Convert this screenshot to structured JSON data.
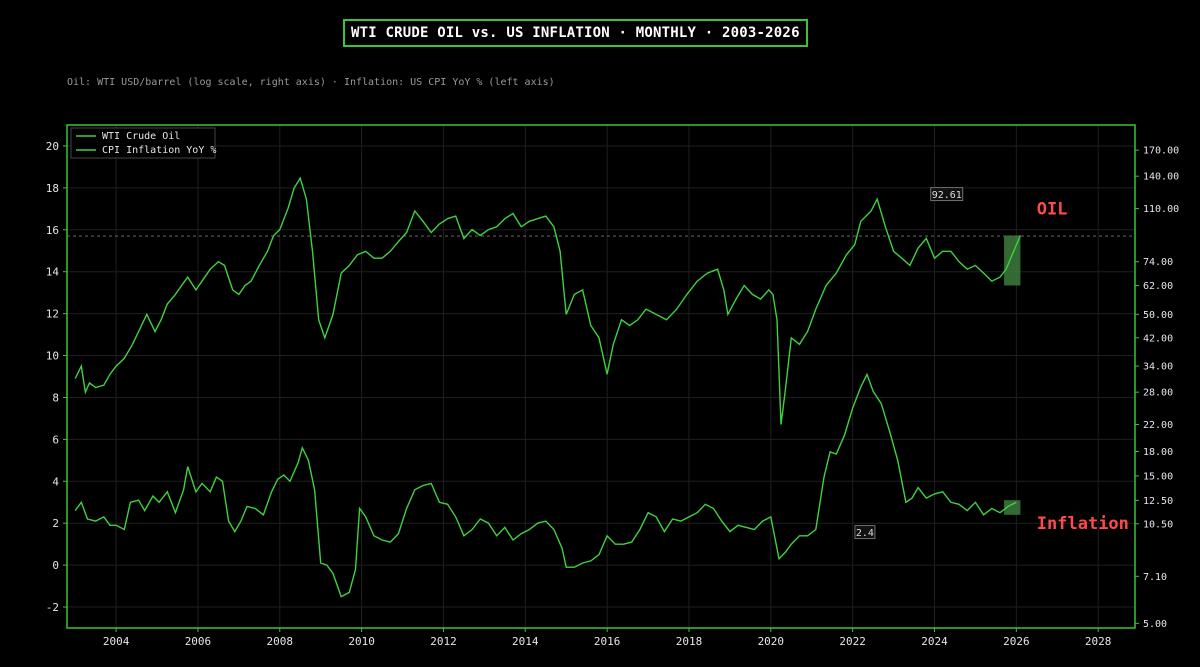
{
  "header": {
    "title": "WTI CRUDE OIL vs. US INFLATION  ·  MONTHLY  ·  2003-2026",
    "subtitle": "Oil: WTI USD/barrel (log scale, right axis)  ·  Inflation: US CPI YoY % (left axis)"
  },
  "colors": {
    "background": "#000000",
    "frame": "#3ac43a",
    "oil_line": "#3fd23f",
    "cpi_line": "#3fd23f",
    "highlight": "#3d7a3d",
    "annotation_red": "#ff4a4a"
  },
  "chart_data": {
    "type": "line",
    "xlim": [
      2002.8,
      2028.9
    ],
    "x_ticks": [
      2004,
      2006,
      2008,
      2010,
      2012,
      2014,
      2016,
      2018,
      2020,
      2022,
      2024,
      2026,
      2028
    ],
    "left_axis": {
      "scale": "linear",
      "ylim": [
        -3,
        21
      ],
      "ticks": [
        -2,
        0,
        2,
        4,
        6,
        8,
        10,
        12,
        14,
        16,
        18,
        20
      ]
    },
    "right_axis": {
      "scale": "log",
      "ylim": [
        4.83,
        205
      ],
      "ticks": [
        5.0,
        7.1,
        10.5,
        12.5,
        15.0,
        18.0,
        22.0,
        28.0,
        34.0,
        42.0,
        50.0,
        62.0,
        74.0,
        110.0,
        140.0,
        170.0
      ]
    },
    "grid": true,
    "legend_position": "top-left",
    "reference_line": {
      "axis": "left",
      "value": 15.7,
      "style": "dashed"
    },
    "series": [
      {
        "name": "WTI Crude Oil",
        "axis": "right",
        "x": [
          2003.0,
          2003.15,
          2003.25,
          2003.35,
          2003.5,
          2003.7,
          2003.85,
          2004.0,
          2004.2,
          2004.4,
          2004.55,
          2004.75,
          2004.95,
          2005.1,
          2005.25,
          2005.45,
          2005.6,
          2005.75,
          2005.95,
          2006.1,
          2006.3,
          2006.5,
          2006.65,
          2006.85,
          2007.0,
          2007.15,
          2007.3,
          2007.5,
          2007.7,
          2007.85,
          2008.0,
          2008.2,
          2008.35,
          2008.5,
          2008.65,
          2008.8,
          2008.95,
          2009.1,
          2009.3,
          2009.5,
          2009.7,
          2009.9,
          2010.1,
          2010.3,
          2010.5,
          2010.7,
          2010.9,
          2011.1,
          2011.3,
          2011.5,
          2011.7,
          2011.9,
          2012.1,
          2012.3,
          2012.5,
          2012.7,
          2012.9,
          2013.1,
          2013.3,
          2013.5,
          2013.7,
          2013.9,
          2014.1,
          2014.3,
          2014.5,
          2014.7,
          2014.85,
          2015.0,
          2015.2,
          2015.4,
          2015.6,
          2015.8,
          2016.0,
          2016.15,
          2016.35,
          2016.55,
          2016.75,
          2016.95,
          2017.2,
          2017.45,
          2017.7,
          2017.95,
          2018.2,
          2018.45,
          2018.7,
          2018.85,
          2018.95,
          2019.15,
          2019.35,
          2019.55,
          2019.75,
          2019.95,
          2020.05,
          2020.15,
          2020.25,
          2020.35,
          2020.5,
          2020.7,
          2020.9,
          2021.1,
          2021.35,
          2021.6,
          2021.85,
          2022.05,
          2022.2,
          2022.45,
          2022.6,
          2022.8,
          2023.0,
          2023.2,
          2023.4,
          2023.6,
          2023.8,
          2024.0,
          2024.2,
          2024.4,
          2024.6,
          2024.8,
          2025.0,
          2025.2,
          2025.4,
          2025.6,
          2025.75,
          2025.9,
          2026.1
        ],
        "values": [
          31.0,
          34.0,
          28.0,
          30.0,
          29.0,
          29.5,
          32.0,
          34.0,
          36.0,
          40.0,
          44.0,
          50.0,
          44.0,
          48.0,
          54.0,
          58.0,
          62.0,
          66.0,
          60.0,
          64.0,
          70.0,
          74.0,
          72.0,
          60.0,
          58.0,
          62.0,
          64.0,
          72.0,
          80.0,
          90.0,
          94.0,
          110.0,
          128.0,
          138.0,
          118.0,
          80.0,
          48.0,
          42.0,
          50.0,
          68.0,
          72.0,
          78.0,
          80.0,
          76.0,
          76.0,
          80.0,
          86.0,
          92.0,
          108.0,
          100.0,
          92.0,
          98.0,
          102.0,
          104.0,
          88.0,
          94.0,
          90.0,
          94.0,
          96.0,
          102.0,
          106.0,
          96.0,
          100.0,
          102.0,
          104.0,
          96.0,
          80.0,
          50.0,
          58.0,
          60.0,
          46.0,
          42.0,
          32.0,
          40.0,
          48.0,
          46.0,
          48.0,
          52.0,
          50.0,
          48.0,
          52.0,
          58.0,
          64.0,
          68.0,
          70.0,
          60.0,
          50.0,
          56.0,
          62.0,
          58.0,
          56.0,
          60.0,
          58.0,
          48.0,
          22.0,
          28.0,
          42.0,
          40.0,
          44.0,
          52.0,
          62.0,
          68.0,
          78.0,
          84.0,
          100.0,
          108.0,
          118.0,
          96.0,
          80.0,
          76.0,
          72.0,
          82.0,
          88.0,
          76.0,
          80.0,
          80.0,
          74.0,
          70.0,
          72.0,
          68.0,
          64.0,
          66.0,
          70.0,
          78.0,
          90.0
        ]
      },
      {
        "name": "CPI Inflation YoY %",
        "axis": "left",
        "x": [
          2003.0,
          2003.15,
          2003.3,
          2003.5,
          2003.7,
          2003.85,
          2004.0,
          2004.2,
          2004.35,
          2004.55,
          2004.7,
          2004.9,
          2005.05,
          2005.25,
          2005.45,
          2005.65,
          2005.75,
          2005.95,
          2006.1,
          2006.3,
          2006.45,
          2006.6,
          2006.75,
          2006.9,
          2007.05,
          2007.2,
          2007.4,
          2007.6,
          2007.8,
          2007.95,
          2008.1,
          2008.25,
          2008.45,
          2008.55,
          2008.7,
          2008.85,
          2009.0,
          2009.15,
          2009.3,
          2009.5,
          2009.7,
          2009.85,
          2009.95,
          2010.1,
          2010.3,
          2010.5,
          2010.7,
          2010.9,
          2011.1,
          2011.3,
          2011.5,
          2011.7,
          2011.9,
          2012.1,
          2012.3,
          2012.5,
          2012.7,
          2012.9,
          2013.1,
          2013.3,
          2013.5,
          2013.7,
          2013.9,
          2014.1,
          2014.3,
          2014.5,
          2014.7,
          2014.9,
          2015.0,
          2015.2,
          2015.4,
          2015.6,
          2015.8,
          2016.0,
          2016.2,
          2016.4,
          2016.6,
          2016.8,
          2017.0,
          2017.2,
          2017.4,
          2017.6,
          2017.8,
          2018.0,
          2018.2,
          2018.4,
          2018.6,
          2018.8,
          2019.0,
          2019.2,
          2019.4,
          2019.6,
          2019.8,
          2020.0,
          2020.2,
          2020.35,
          2020.5,
          2020.7,
          2020.9,
          2021.1,
          2021.3,
          2021.45,
          2021.6,
          2021.8,
          2022.0,
          2022.2,
          2022.35,
          2022.5,
          2022.7,
          2022.9,
          2023.1,
          2023.3,
          2023.45,
          2023.6,
          2023.8,
          2024.0,
          2024.2,
          2024.4,
          2024.6,
          2024.8,
          2025.0,
          2025.2,
          2025.4,
          2025.6,
          2025.8,
          2026.0
        ],
        "values": [
          2.6,
          3.0,
          2.2,
          2.1,
          2.3,
          1.9,
          1.9,
          1.7,
          3.0,
          3.1,
          2.6,
          3.3,
          3.0,
          3.5,
          2.5,
          3.6,
          4.7,
          3.5,
          3.9,
          3.5,
          4.2,
          4.0,
          2.1,
          1.6,
          2.1,
          2.8,
          2.7,
          2.4,
          3.5,
          4.1,
          4.3,
          4.0,
          4.9,
          5.6,
          5.0,
          3.6,
          0.1,
          0.0,
          -0.4,
          -1.5,
          -1.3,
          -0.2,
          2.7,
          2.3,
          1.4,
          1.2,
          1.1,
          1.5,
          2.7,
          3.6,
          3.8,
          3.9,
          3.0,
          2.9,
          2.3,
          1.4,
          1.7,
          2.2,
          2.0,
          1.4,
          1.8,
          1.2,
          1.5,
          1.7,
          2.0,
          2.1,
          1.7,
          0.8,
          -0.1,
          -0.1,
          0.1,
          0.2,
          0.5,
          1.4,
          1.0,
          1.0,
          1.1,
          1.7,
          2.5,
          2.3,
          1.6,
          2.2,
          2.1,
          2.3,
          2.5,
          2.9,
          2.7,
          2.1,
          1.6,
          1.9,
          1.8,
          1.7,
          2.1,
          2.3,
          0.3,
          0.6,
          1.0,
          1.4,
          1.4,
          1.7,
          4.2,
          5.4,
          5.3,
          6.2,
          7.5,
          8.5,
          9.1,
          8.3,
          7.7,
          6.4,
          5.0,
          3.0,
          3.2,
          3.7,
          3.2,
          3.4,
          3.5,
          3.0,
          2.9,
          2.6,
          3.0,
          2.4,
          2.7,
          2.5,
          2.8,
          3.0
        ]
      }
    ],
    "annotations": [
      {
        "text": "92.61",
        "x": 2024.3,
        "axis": "right",
        "y": 122
      },
      {
        "text": "2.4",
        "x": 2022.3,
        "axis": "left",
        "y": 1.55
      },
      {
        "text": "OIL",
        "x": 2026.5,
        "axis": "right",
        "y": 110
      },
      {
        "text": "Inflation",
        "x": 2026.5,
        "axis": "left",
        "y": 2.0
      }
    ],
    "highlights": [
      {
        "x": [
          2025.7,
          2026.1
        ],
        "axis": "right",
        "y": [
          62,
          90
        ]
      },
      {
        "x": [
          2025.7,
          2026.1
        ],
        "axis": "left",
        "y": [
          2.4,
          3.1
        ]
      }
    ]
  }
}
